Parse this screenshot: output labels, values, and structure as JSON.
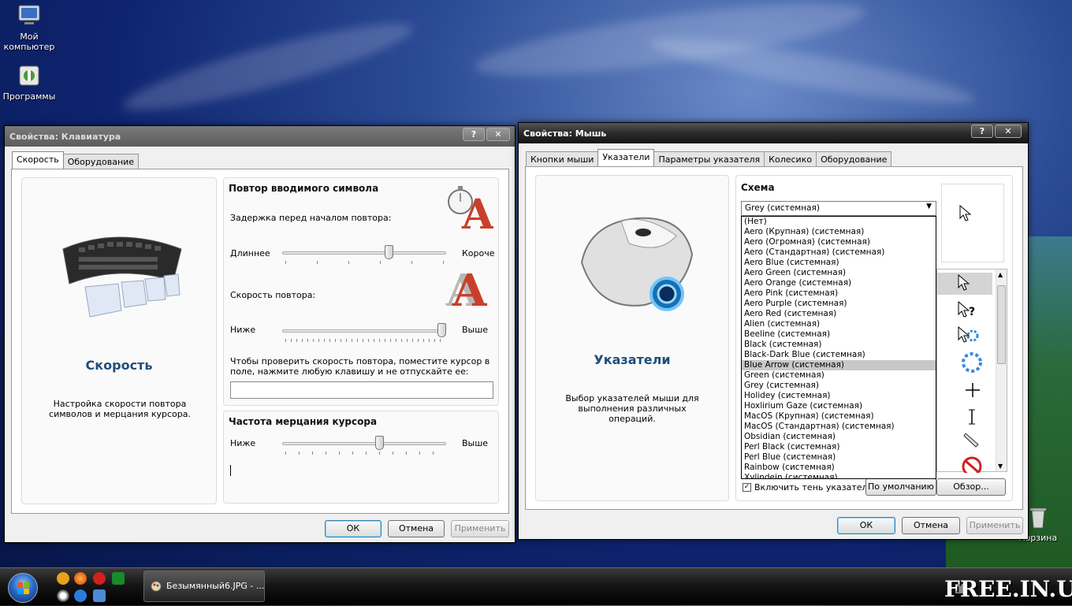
{
  "desktop": {
    "icons": [
      {
        "label": "Мой\nкомпьютер",
        "icon": "my-computer-icon"
      },
      {
        "label": "Программы",
        "icon": "programs-icon"
      },
      {
        "label": "Корзина",
        "icon": "recycle-bin-icon"
      }
    ],
    "watermark": "FREE.IN.UA"
  },
  "keyboard_window": {
    "title": "Свойства: Клавиатура",
    "help_btn": "?",
    "close_btn": "✕",
    "tabs": [
      "Скорость",
      "Оборудование"
    ],
    "left": {
      "title": "Скорость",
      "description": "Настройка скорости повтора символов и мерцания курсора."
    },
    "repeat": {
      "heading": "Повтор вводимого символа",
      "delay_label": "Задержка перед началом повтора:",
      "delay_left": "Длиннее",
      "delay_right": "Короче",
      "delay_value": 0.66,
      "rate_label": "Скорость повтора:",
      "rate_left": "Ниже",
      "rate_right": "Выше",
      "rate_value": 1.0,
      "test_label": "Чтобы проверить скорость повтора, поместите курсор в поле, нажмите любую клавишу и не отпускайте ее:",
      "test_value": ""
    },
    "blink": {
      "heading": "Частота мерцания курсора",
      "left": "Ниже",
      "right": "Выше",
      "value": 0.6
    },
    "buttons": {
      "ok": "ОК",
      "cancel": "Отмена",
      "apply": "Применить"
    }
  },
  "mouse_window": {
    "title": "Свойства: Мышь",
    "help_btn": "?",
    "close_btn": "✕",
    "tabs": [
      "Кнопки мыши",
      "Указатели",
      "Параметры указателя",
      "Колесико",
      "Оборудование"
    ],
    "left": {
      "title": "Указатели",
      "description": "Выбор указателей мыши для выполнения различных операций."
    },
    "scheme_label": "Схема",
    "scheme_selected": "Grey (системная)",
    "scheme_options": [
      "(Нет)",
      "Aero (Крупная) (системная)",
      "Aero (Огромная) (системная)",
      "Aero (Стандартная) (системная)",
      "Aero Blue (системная)",
      "Aero Green (системная)",
      "Aero Orange (системная)",
      "Aero Pink (системная)",
      "Aero Purple (системная)",
      "Aero Red (системная)",
      "Alien (системная)",
      "Beeline (системная)",
      "Black (системная)",
      "Black-Dark Blue (системная)",
      "Blue Arrow (системная)",
      "Green (системная)",
      "Grey (системная)",
      "Holidey (системная)",
      "Hoxlirium Gaze (системная)",
      "MacOS (Крупная) (системная)",
      "MacOS (Стандартная) (системная)",
      "Obsidian (системная)",
      "Perl Black (системная)",
      "Perl Blue (системная)",
      "Rainbow (системная)",
      "Xylindein (системная)"
    ],
    "highlighted_option": "Blue Arrow (системная)",
    "shadow_checkbox": "Включить тень указателя",
    "default_btn": "По умолчанию",
    "browse_btn": "Обзор...",
    "buttons": {
      "ok": "ОК",
      "cancel": "Отмена",
      "apply": "Применить"
    }
  },
  "taskbar": {
    "task_label": "Безымянный6.JPG - ..."
  }
}
